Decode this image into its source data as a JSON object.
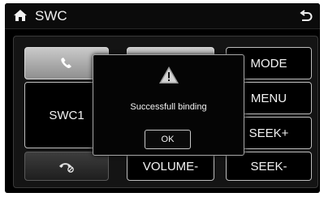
{
  "header": {
    "title": "SWC"
  },
  "buttons": {
    "swc1": "SWC1",
    "mode": "MODE",
    "menu": "MENU",
    "seek_plus": "SEEK+",
    "volume_minus": "VOLUME-",
    "seek_minus": "SEEK-"
  },
  "dialog": {
    "message": "Successfull binding",
    "ok_label": "OK"
  },
  "colors": {
    "background": "#000000",
    "button_border": "#bdbdbd",
    "text": "#f3f3f3"
  },
  "icons": [
    "home-icon",
    "back-icon",
    "phone-icon",
    "hang-up-icon",
    "warning-icon"
  ]
}
